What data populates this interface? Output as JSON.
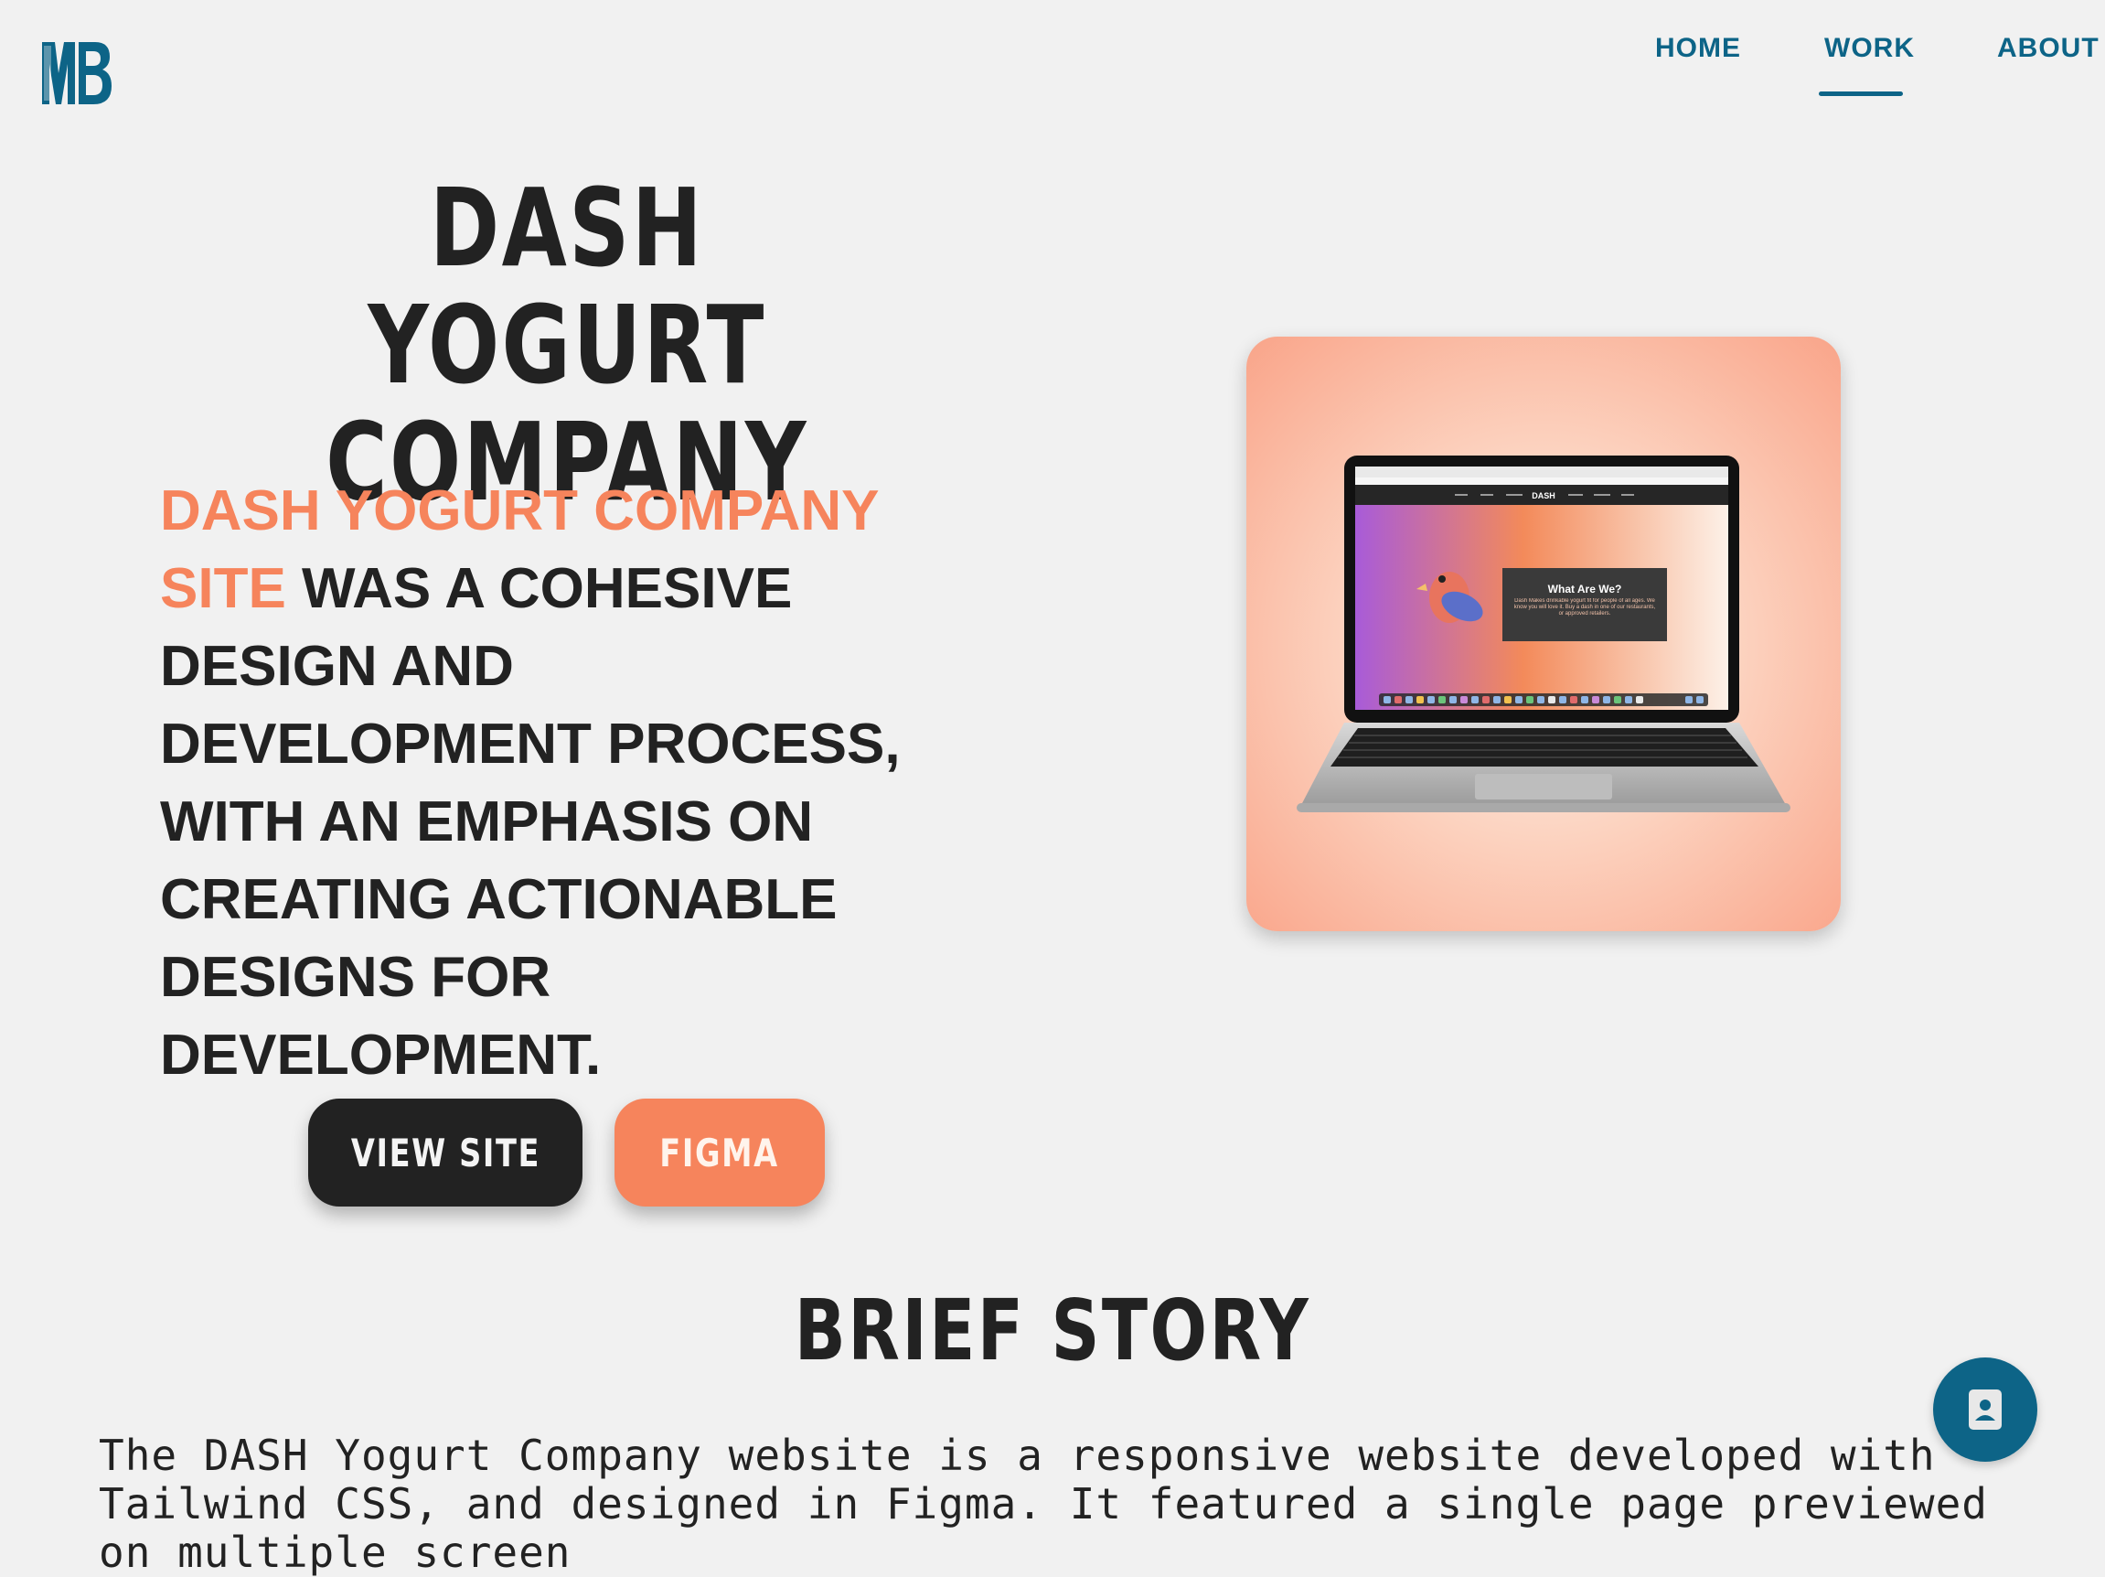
{
  "nav": {
    "logo_icon": "mb-monogram-logo",
    "items": [
      {
        "label": "HOME"
      },
      {
        "label": "WORK"
      },
      {
        "label": "ABOUT"
      }
    ],
    "active": "WORK"
  },
  "hero": {
    "title_line1": "DASH YOGURT",
    "title_line2": "COMPANY",
    "desc_highlight": "Dash Yogurt Company site",
    "desc_rest": " was a cohesive design and development process, with an emphasis on creating actionable designs for development.",
    "buttons": {
      "view_site": "VIEW SITE",
      "figma": "FIGMA"
    },
    "mockup": {
      "browser_logo": "DASH",
      "card_title": "What Are We?",
      "card_body": "Dash Makes drinkable yogurt fit for people of all ages. We know you will love it. Buy a dash in one of our restaurants, or approved retailers."
    }
  },
  "story": {
    "heading": "BRIEF STORY",
    "text": "The DASH Yogurt Company website is a responsive website developed with Tailwind CSS, and designed in Figma. It featured a single page previewed on multiple screen"
  },
  "fab": {
    "icon": "contact-card-icon"
  },
  "colors": {
    "accent": "#f6845c",
    "brand": "#0d6487",
    "dark": "#222222",
    "background": "#f1f1f1"
  }
}
